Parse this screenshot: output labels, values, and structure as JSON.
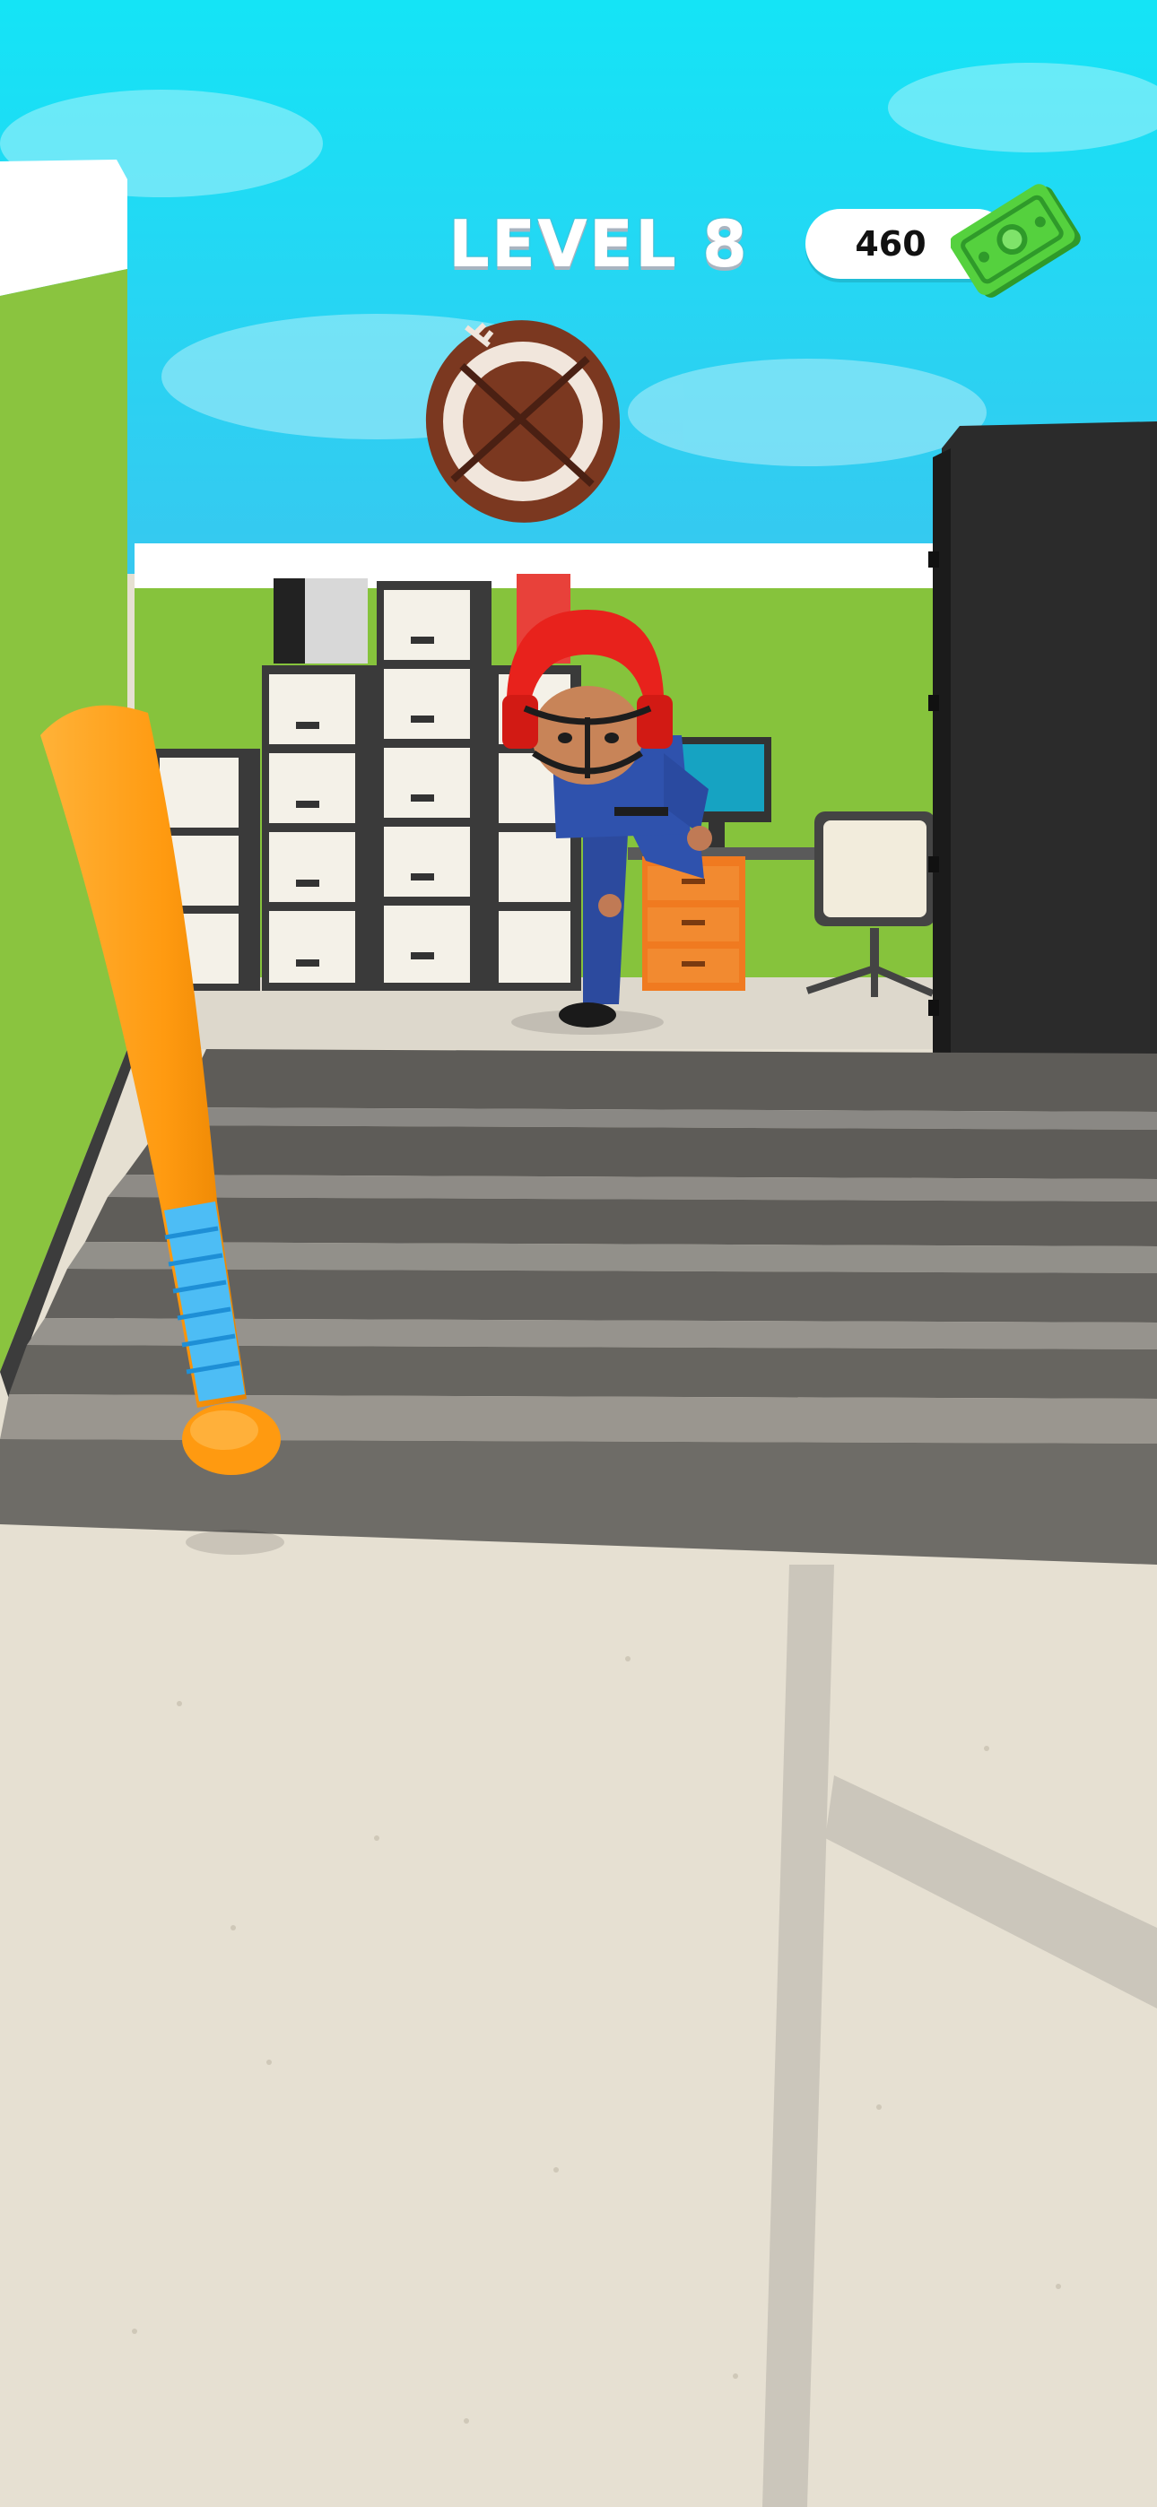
{
  "hud": {
    "level_label": "LEVEL 8",
    "money": "460"
  },
  "icons": {
    "money": "cash-bill-icon",
    "ball": "football-ball",
    "bat": "baseball-bat"
  },
  "colors": {
    "sky": "#21d9f5",
    "wall_green": "#8ac43f",
    "floor": "#e6e0d2",
    "bat_orange": "#ff9d12",
    "bat_grip": "#45b8f0",
    "helmet_red": "#e8221c",
    "uniform_blue": "#2d4fa8",
    "cash_green": "#4ecb3a"
  }
}
